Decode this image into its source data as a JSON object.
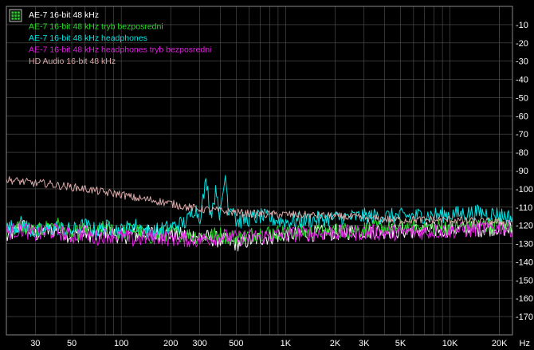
{
  "chart_data": {
    "type": "line",
    "x_scale": "log",
    "xlim": [
      20,
      24000
    ],
    "ylim": [
      -180,
      0
    ],
    "grid": true,
    "legend_position": "top-left",
    "x_unit": "Hz",
    "x_ticks": [
      {
        "v": 30,
        "label": "30"
      },
      {
        "v": 50,
        "label": "50"
      },
      {
        "v": 100,
        "label": "100"
      },
      {
        "v": 200,
        "label": "200"
      },
      {
        "v": 300,
        "label": "300"
      },
      {
        "v": 500,
        "label": "500"
      },
      {
        "v": 1000,
        "label": "1K"
      },
      {
        "v": 2000,
        "label": "2K"
      },
      {
        "v": 3000,
        "label": "3K"
      },
      {
        "v": 5000,
        "label": "5K"
      },
      {
        "v": 10000,
        "label": "10K"
      },
      {
        "v": 20000,
        "label": "20K"
      }
    ],
    "y_ticks": [
      "-10",
      "-20",
      "-30",
      "-40",
      "-50",
      "-60",
      "-70",
      "-80",
      "-90",
      "-100",
      "-110",
      "-120",
      "-130",
      "-140",
      "-150",
      "-160",
      "-170"
    ],
    "series": [
      {
        "name": "AE-7 16-bit 48 kHz",
        "color": "#ffffff",
        "x": [
          20,
          25,
          30,
          40,
          50,
          60,
          70,
          80,
          100,
          120,
          150,
          200,
          300,
          400,
          500,
          700,
          1000,
          2000,
          3000,
          5000,
          10000,
          15000,
          20000,
          24000
        ],
        "y": [
          -127,
          -120,
          -125,
          -122,
          -126,
          -124,
          -126,
          -123,
          -126,
          -125,
          -124,
          -125,
          -126,
          -128,
          -130,
          -127,
          -125,
          -124,
          -123,
          -123,
          -122,
          -122,
          -121,
          -123
        ]
      },
      {
        "name": "AE-7 16-bit 48 kHz tryb bezposredni",
        "color": "#22dd22",
        "x": [
          20,
          25,
          30,
          40,
          50,
          60,
          70,
          80,
          100,
          120,
          150,
          200,
          300,
          400,
          500,
          700,
          1000,
          2000,
          3000,
          5000,
          10000,
          15000,
          20000,
          24000
        ],
        "y": [
          -124,
          -120,
          -124,
          -119,
          -126,
          -122,
          -125,
          -121,
          -124,
          -122,
          -126,
          -124,
          -126,
          -125,
          -127,
          -124,
          -124,
          -123,
          -122,
          -121,
          -121,
          -120,
          -120,
          -121
        ]
      },
      {
        "name": "AE-7 16-bit 48 kHz headphones",
        "color": "#00e5e5",
        "x": [
          20,
          25,
          30,
          40,
          50,
          60,
          70,
          80,
          100,
          120,
          150,
          200,
          250,
          280,
          300,
          330,
          350,
          380,
          400,
          430,
          450,
          480,
          500,
          700,
          1000,
          2000,
          3000,
          5000,
          10000,
          15000,
          20000,
          24000
        ],
        "y": [
          -122,
          -119,
          -124,
          -121,
          -123,
          -120,
          -123,
          -121,
          -123,
          -120,
          -124,
          -121,
          -118,
          -110,
          -116,
          -95,
          -114,
          -100,
          -116,
          -92,
          -112,
          -108,
          -118,
          -115,
          -118,
          -116,
          -115,
          -115,
          -114,
          -113,
          -114,
          -116
        ]
      },
      {
        "name": "AE-7 16-bit 48 kHz headphones tryb bezposredni",
        "color": "#e020e0",
        "x": [
          20,
          25,
          30,
          40,
          50,
          60,
          70,
          80,
          100,
          120,
          150,
          200,
          300,
          400,
          500,
          700,
          1000,
          2000,
          3000,
          5000,
          10000,
          15000,
          20000,
          24000
        ],
        "y": [
          -124,
          -122,
          -125,
          -123,
          -126,
          -124,
          -127,
          -125,
          -126,
          -128,
          -126,
          -127,
          -128,
          -126,
          -127,
          -126,
          -125,
          -124,
          -124,
          -124,
          -123,
          -122,
          -121,
          -122
        ]
      },
      {
        "name": "HD Audio 16-bit 48 kHz",
        "color": "#d8a8a8",
        "x": [
          20,
          25,
          30,
          35,
          40,
          50,
          60,
          70,
          80,
          100,
          120,
          150,
          200,
          250,
          300,
          400,
          500,
          700,
          1000,
          2000,
          3000,
          5000,
          10000,
          15000,
          20000,
          24000
        ],
        "y": [
          -95,
          -96,
          -97,
          -97,
          -98,
          -99,
          -100,
          -101,
          -102,
          -103,
          -105,
          -106,
          -108,
          -110,
          -111,
          -112,
          -113,
          -114,
          -114,
          -115,
          -116,
          -117,
          -117,
          -118,
          -118,
          -118
        ]
      }
    ]
  }
}
